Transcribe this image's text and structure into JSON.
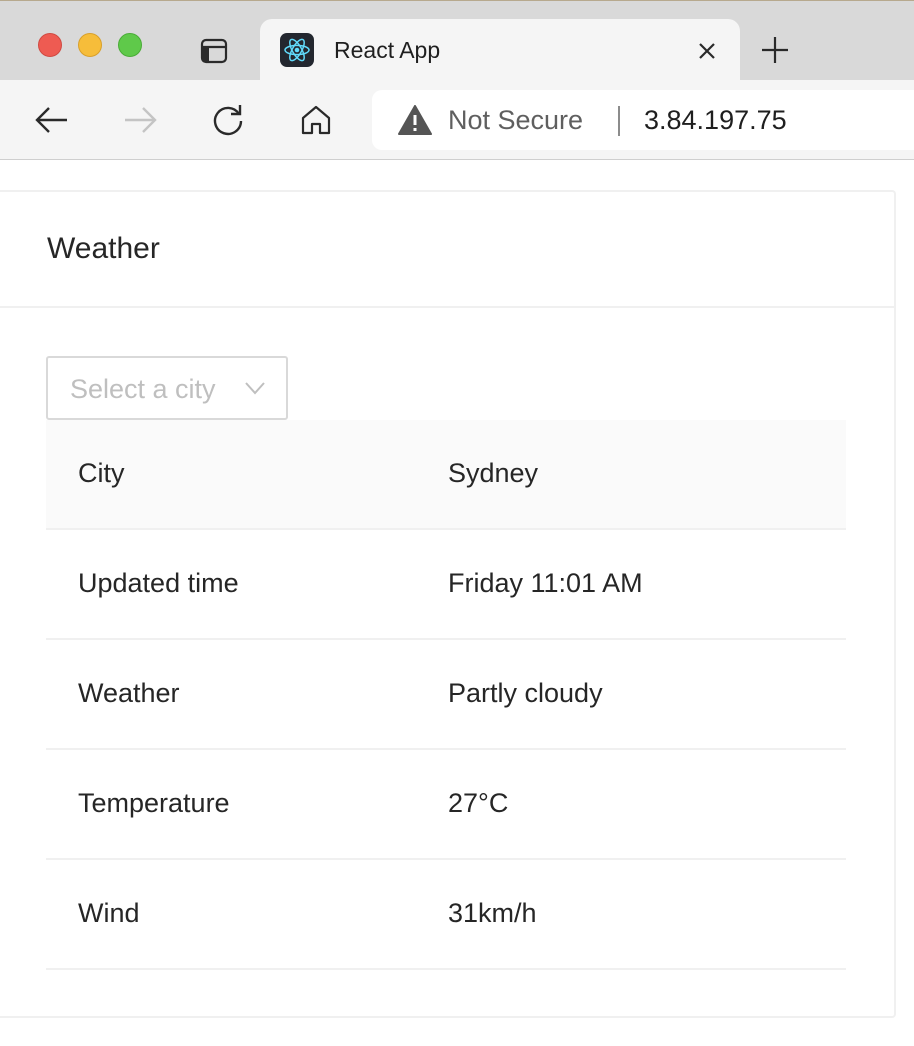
{
  "browser": {
    "tab": {
      "title": "React App",
      "favicon": "react-icon"
    },
    "address_bar": {
      "security_label": "Not Secure",
      "url": "3.84.197.75"
    },
    "icons": {
      "tab_list": "sidebar-tabs-icon",
      "close": "close-icon",
      "new_tab": "plus-icon",
      "back": "arrow-left-icon",
      "forward": "arrow-right-icon",
      "reload": "reload-icon",
      "home": "home-icon",
      "warning": "warning-triangle-icon"
    }
  },
  "page": {
    "card_title": "Weather",
    "city_select": {
      "placeholder": "Select a city",
      "icon": "chevron-down-icon"
    },
    "table": {
      "rows": [
        {
          "label": "City",
          "value": "Sydney"
        },
        {
          "label": "Updated time",
          "value": "Friday 11:01 AM"
        },
        {
          "label": "Weather",
          "value": "Partly cloudy"
        },
        {
          "label": "Temperature",
          "value": "27°C"
        },
        {
          "label": "Wind",
          "value": "31km/h"
        }
      ]
    }
  },
  "colors": {
    "traffic_red": "#ee5b52",
    "traffic_yellow": "#f6bd3a",
    "traffic_green": "#5fc94a",
    "react_blue": "#61dafb",
    "border": "#f0f0f0",
    "placeholder": "#bfbfbf"
  }
}
